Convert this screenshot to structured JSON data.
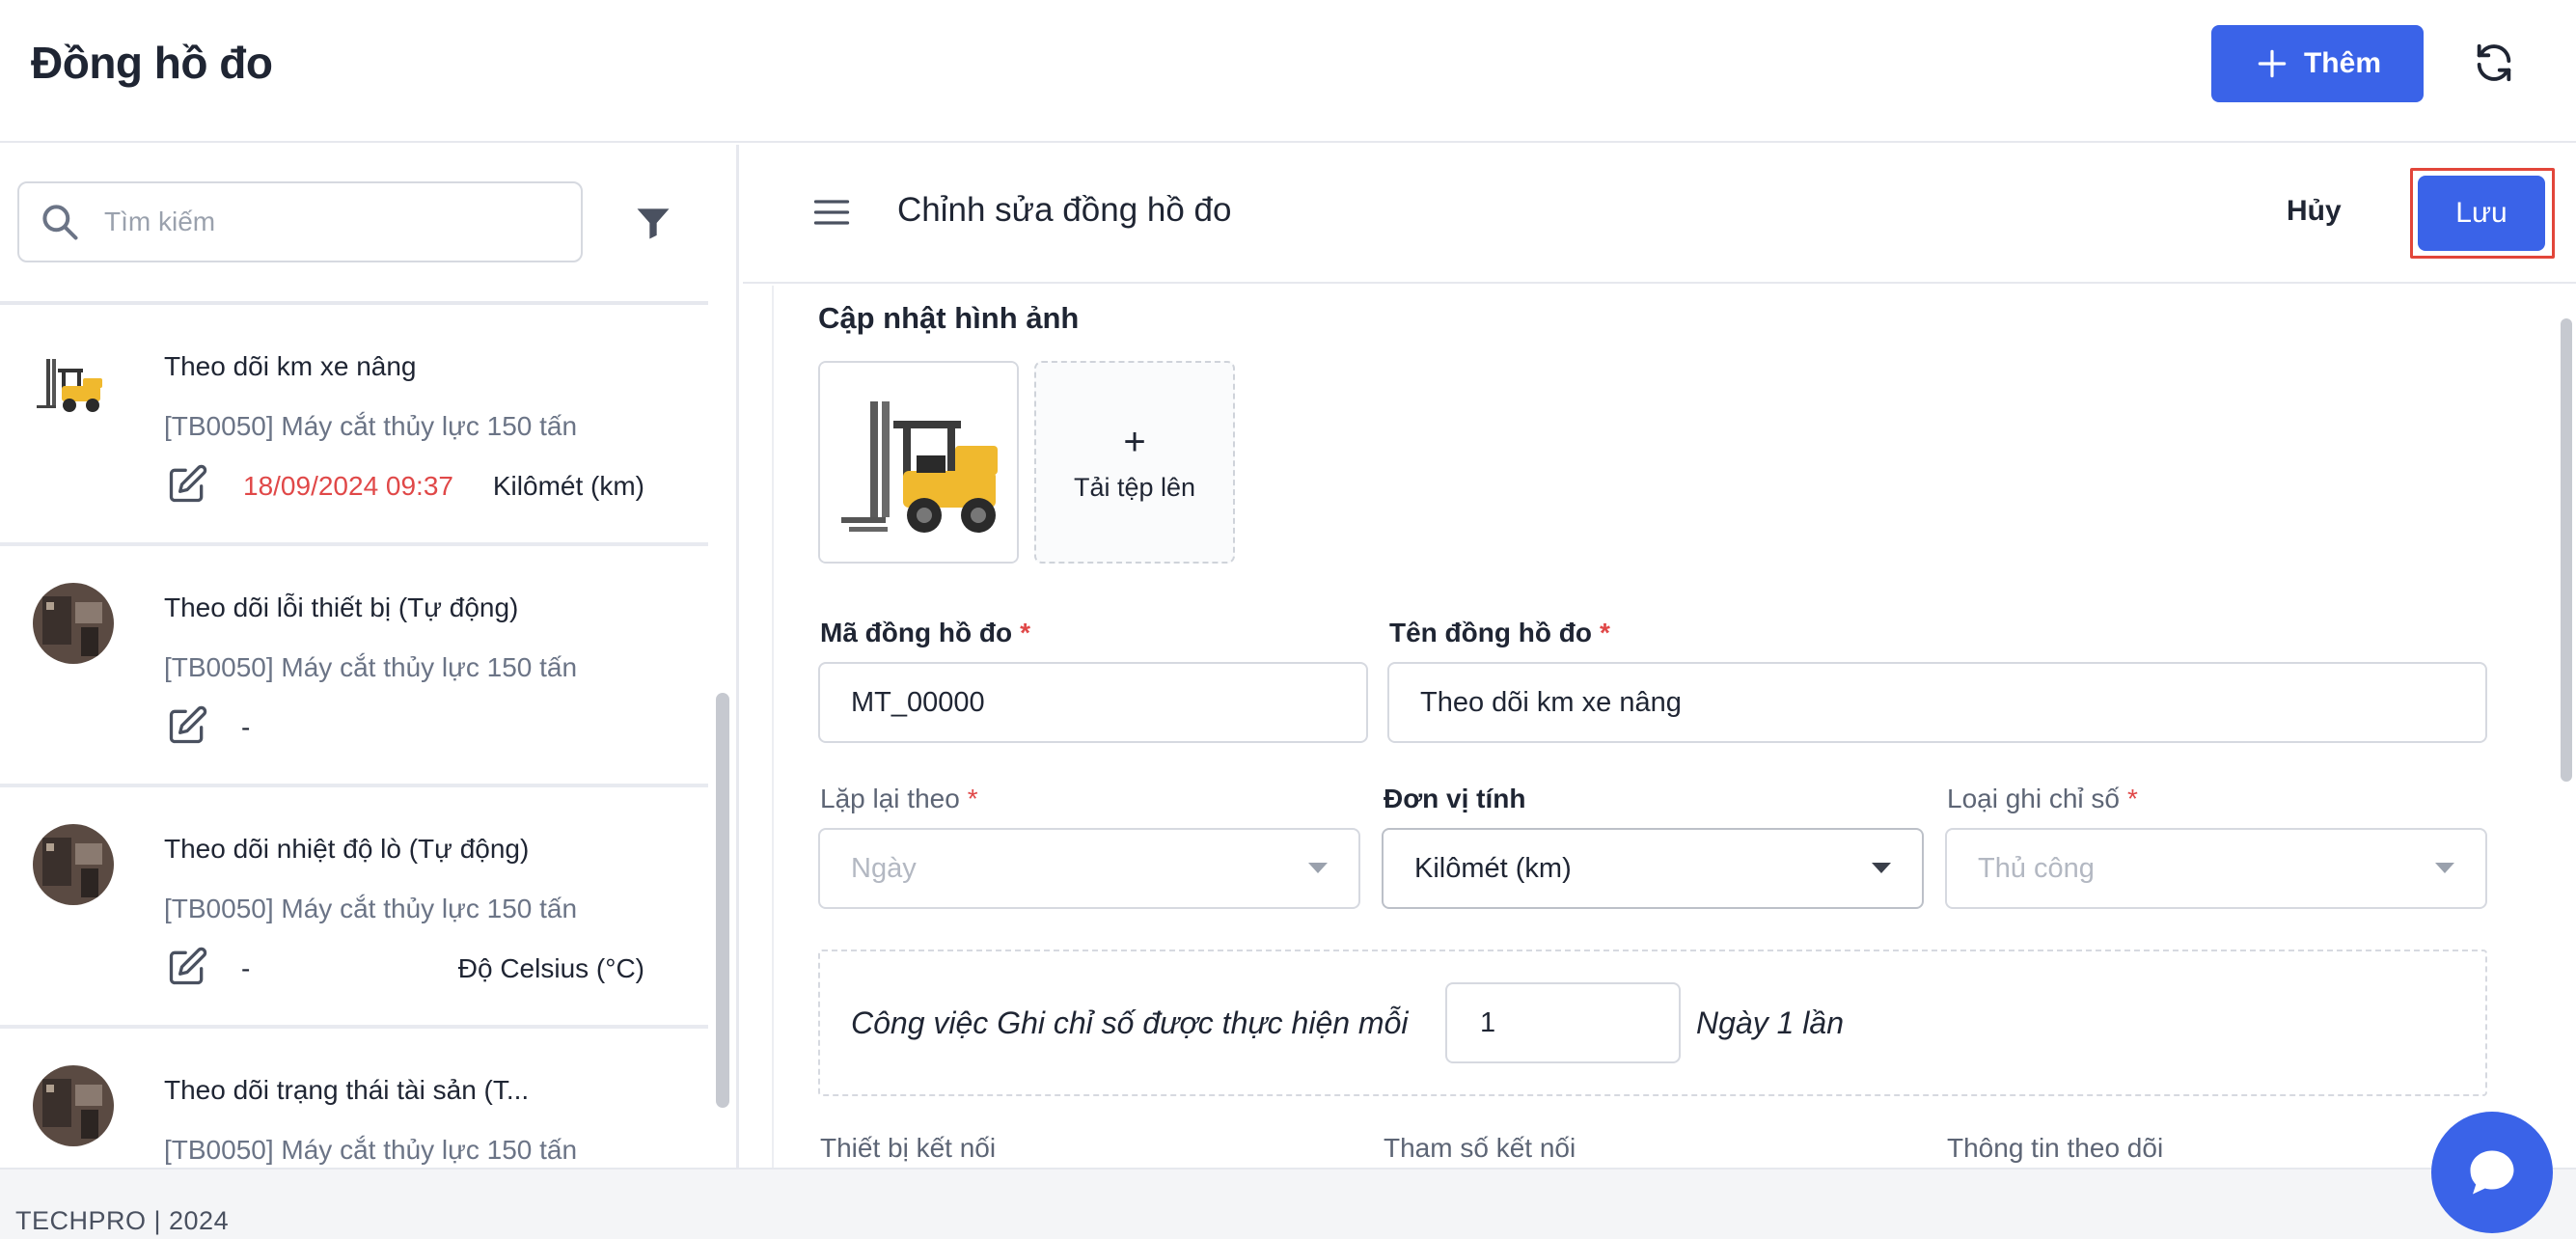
{
  "header": {
    "title": "Đồng hồ đo",
    "add_label": "Thêm",
    "add_icon": "plus-icon",
    "refresh_icon": "refresh-icon"
  },
  "sidebar": {
    "search_placeholder": "Tìm kiếm",
    "search_icon": "search-icon",
    "filter_icon": "filter-icon",
    "items": [
      {
        "name": "Theo dõi km xe nâng",
        "device": "[TB0050] Máy cắt thủy lực 150 tấn",
        "last_reading": "18/09/2024 09:37",
        "unit": "Kilômét (km)",
        "thumb": "forklift-image"
      },
      {
        "name": "Theo dõi lỗi thiết bị (Tự động)",
        "device": "[TB0050] Máy cắt thủy lực 150 tấn",
        "last_reading": "-",
        "unit": "",
        "thumb": "machine-image"
      },
      {
        "name": "Theo dõi nhiệt độ lò (Tự động)",
        "device": "[TB0050] Máy cắt thủy lực 150 tấn",
        "last_reading": "-",
        "unit": "Độ Celsius (°C)",
        "thumb": "machine-image"
      },
      {
        "name": "Theo dõi trạng thái tài sản (T...",
        "device": "[TB0050] Máy cắt thủy lực 150 tấn",
        "last_reading": "",
        "unit": "",
        "thumb": "machine-image"
      }
    ],
    "accent_date_color": "#e04848"
  },
  "form_header": {
    "title": "Chỉnh sửa đồng hồ đo",
    "cancel_label": "Hủy",
    "save_label": "Lưu",
    "menu_icon": "hamburger-menu-icon"
  },
  "form": {
    "image_section_label": "Cập nhật hình ảnh",
    "upload_label": "Tải tệp lên",
    "code": {
      "label": "Mã đồng hồ đo",
      "required_mark": "*",
      "value": "MT_00000"
    },
    "name": {
      "label": "Tên đồng hồ đo",
      "required_mark": "*",
      "value": "Theo dõi km xe nâng"
    },
    "repeat": {
      "label": "Lặp lại theo",
      "required_mark": "*",
      "value": "Ngày"
    },
    "unit": {
      "label": "Đơn vị tính",
      "value": "Kilômét (km)"
    },
    "reading_type": {
      "label": "Loại ghi chỉ số",
      "required_mark": "*",
      "value": "Thủ công"
    },
    "interval": {
      "prefix": "Công việc Ghi chỉ số được thực hiện mỗi",
      "value": "1",
      "suffix": "Ngày 1 lần"
    },
    "bottom_labels": {
      "connected_device": "Thiết bị kết nối",
      "connection_param": "Tham số kết nối",
      "tracking_info": "Thông tin theo dõi"
    }
  },
  "footer": {
    "text": "TECHPRO | 2024"
  },
  "chat_icon": "chat-bubble-icon",
  "colors": {
    "primary": "#3a63e8",
    "required": "#e04848",
    "highlight_outline": "#e2463a"
  }
}
